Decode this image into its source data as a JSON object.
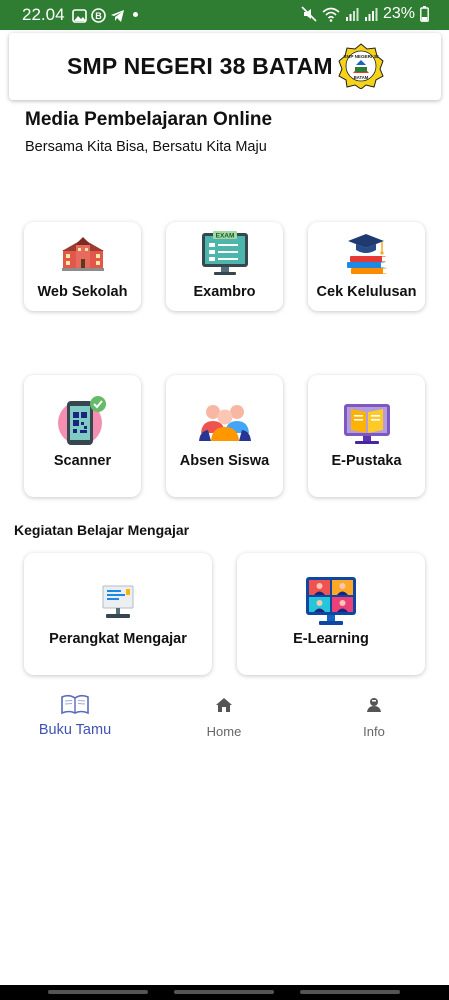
{
  "status_bar": {
    "time": "22.04",
    "battery": "23%",
    "icons": [
      "image-icon",
      "b-icon",
      "telegram-icon",
      "mute-icon",
      "wifi-icon",
      "signal-icon",
      "signal-icon",
      "battery-icon"
    ]
  },
  "header": {
    "school_name": "SMP NEGERI 38 BATAM",
    "logo_text": "SMP NEGERI 38",
    "logo_sub": "BATAM"
  },
  "intro": {
    "title": "Media Pembelajaran Online",
    "subtitle": "Bersama Kita Bisa, Bersatu Kita Maju"
  },
  "menu": [
    {
      "label": "Web Sekolah",
      "icon": "school-building-icon"
    },
    {
      "label": "Exambro",
      "icon": "exam-monitor-icon"
    },
    {
      "label": "Cek Kelulusan",
      "icon": "graduation-books-icon"
    },
    {
      "label": "Scanner",
      "icon": "qr-phone-icon"
    },
    {
      "label": "Absen Siswa",
      "icon": "students-group-icon"
    },
    {
      "label": "E-Pustaka",
      "icon": "ebook-monitor-icon"
    }
  ],
  "kbm": {
    "title": "Kegiatan Belajar Mengajar",
    "items": [
      {
        "label": "Perangkat Mengajar",
        "icon": "document-stack-icon"
      },
      {
        "label": "E-Learning",
        "icon": "video-class-icon"
      }
    ]
  },
  "exam_icon_text": "EXAM",
  "bottom_nav": [
    {
      "label": "Buku Tamu",
      "icon": "book-icon",
      "active": true
    },
    {
      "label": "Home",
      "icon": "home-icon",
      "active": false
    },
    {
      "label": "Info",
      "icon": "person-info-icon",
      "active": false
    }
  ],
  "colors": {
    "status_bar": "#2f7d32",
    "nav_active": "#3f51b5",
    "nav_inactive": "#666666"
  }
}
